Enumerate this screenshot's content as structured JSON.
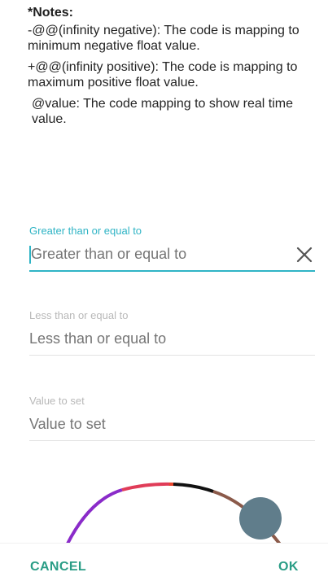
{
  "notes": {
    "title": "*Notes:",
    "items": [
      "-@@(infinity negative): The code is mapping to minimum negative float value.",
      "+@@(infinity positive): The code is mapping to maximum positive float value.",
      "@value: The code mapping to show real time value."
    ]
  },
  "form": {
    "gte": {
      "label": "Greater than or equal to",
      "placeholder": "Greater than or equal to",
      "value": ""
    },
    "lte": {
      "label": "Less than or equal to",
      "placeholder": "Less than or equal to",
      "value": ""
    },
    "value_to_set": {
      "label": "Value to set",
      "placeholder": "Value to set",
      "value": ""
    }
  },
  "dial": {
    "segment_colors": [
      "#8a2bc9",
      "#e03c58",
      "#e8462d",
      "#111111",
      "#8b5a4a"
    ],
    "knob_color": "#607d8b"
  },
  "actions": {
    "cancel": "CANCEL",
    "ok": "OK"
  },
  "colors": {
    "accent": "#2fb4c5",
    "button": "#2a9d86"
  }
}
